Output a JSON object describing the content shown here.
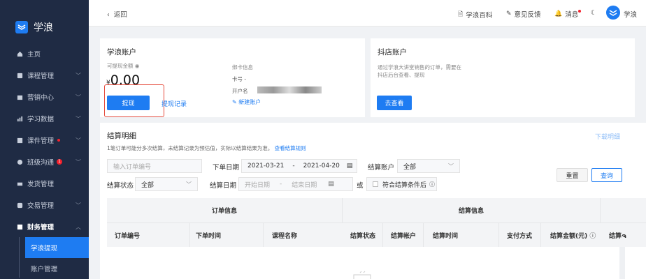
{
  "brand": {
    "name": "学浪",
    "color": "#1e7cf2"
  },
  "sidebar": {
    "items": [
      {
        "label": "主页",
        "icon": "home-icon"
      },
      {
        "label": "课程管理",
        "icon": "book-icon"
      },
      {
        "label": "营销中心",
        "icon": "marketing-icon"
      },
      {
        "label": "学习数据",
        "icon": "chart-icon"
      },
      {
        "label": "课件管理",
        "icon": "courseware-icon"
      },
      {
        "label": "班级沟通",
        "icon": "chat-icon",
        "badge": "1"
      },
      {
        "label": "发货管理",
        "icon": "shipping-icon"
      },
      {
        "label": "交易管理",
        "icon": "trade-icon"
      },
      {
        "label": "财务管理",
        "icon": "finance-icon"
      }
    ],
    "sub_items": [
      {
        "label": "学浪提现",
        "active": true
      },
      {
        "label": "账户管理",
        "active": false
      }
    ]
  },
  "topbar": {
    "back": "返回",
    "links": [
      "学浪百科",
      "意见反馈",
      "消息"
    ],
    "user": "学浪"
  },
  "account": {
    "title": "学浪账户",
    "balance_label": "可提现金额",
    "currency": "¥",
    "balance": "0.00",
    "withdraw_btn": "提现",
    "history_link": "提现记录",
    "bind_title": "绑卡信息",
    "card_no_label": "卡号",
    "card_no_value": "-",
    "holder_label": "开户名",
    "new_account_link": "新建账户"
  },
  "store": {
    "title": "抖店账户",
    "desc_line1": "通过学浪大讲堂销售的订单，需要在",
    "desc_line2": "抖店后台查看、提现",
    "btn": "去查看"
  },
  "settlement": {
    "title": "结算明细",
    "download": "下载明细",
    "note": "1笔订单可能分多次结算，未结算记录为预估值，实际以结算结果为准。",
    "rule_link": "查看结算规则",
    "filters": {
      "order_no_placeholder": "输入订单编号",
      "order_date_label": "下单日期",
      "order_date_start": "2021-03-21",
      "order_date_sep": "-",
      "order_date_end": "2021-04-20",
      "account_label": "结算账户",
      "account_value": "全部",
      "status_label": "结算状态",
      "status_value": "全部",
      "settle_date_label": "结算日期",
      "start_placeholder": "开始日期",
      "end_placeholder": "结束日期",
      "or": "或",
      "checkbox_label": "符合结算条件后",
      "reset_btn": "重置",
      "query_btn": "查询"
    },
    "table": {
      "group1": "订单信息",
      "group2": "结算信息",
      "columns": [
        "订单编号",
        "下单时间",
        "课程名称",
        "结算状态",
        "结算帐户",
        "结算时间",
        "支付方式",
        "结算金额(元)",
        "结算ຈ"
      ]
    }
  }
}
